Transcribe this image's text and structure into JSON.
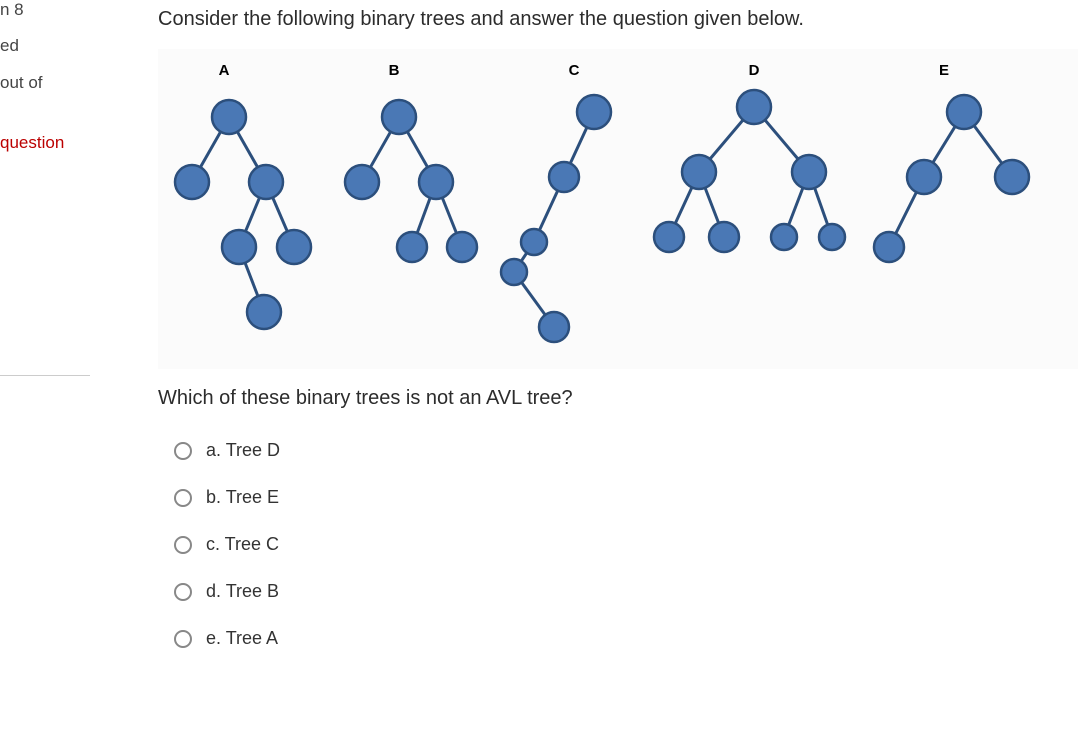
{
  "side": {
    "qnum": "n 8",
    "line2": "ed",
    "line3": "out of",
    "line4": "question"
  },
  "prompt": "Consider the following binary trees and answer the question given below.",
  "question": "Which of these binary trees is not an AVL tree?",
  "labels": {
    "a": "A",
    "b": "B",
    "c": "C",
    "d": "D",
    "e": "E"
  },
  "choices": {
    "a": "a. Tree D",
    "b": "b. Tree E",
    "c": "c. Tree C",
    "d": "d. Tree B",
    "e": "e. Tree A"
  },
  "chart_data": {
    "type": "diagram",
    "description": "Five binary trees labeled A through E drawn with blue nodes and edges.",
    "trees": {
      "A": {
        "root": 1,
        "edges": [
          [
            1,
            2,
            "left"
          ],
          [
            1,
            3,
            "right"
          ],
          [
            3,
            4,
            "left"
          ],
          [
            3,
            5,
            "right"
          ],
          [
            4,
            6,
            "right"
          ]
        ]
      },
      "B": {
        "root": 1,
        "edges": [
          [
            1,
            2,
            "left"
          ],
          [
            1,
            3,
            "right"
          ],
          [
            3,
            4,
            "left"
          ],
          [
            3,
            5,
            "right"
          ]
        ]
      },
      "C": {
        "root": 1,
        "edges": [
          [
            1,
            2,
            "left"
          ],
          [
            2,
            3,
            "left"
          ],
          [
            3,
            4,
            "left"
          ],
          [
            4,
            5,
            "right"
          ]
        ]
      },
      "D": {
        "root": 1,
        "edges": [
          [
            1,
            2,
            "left"
          ],
          [
            1,
            3,
            "right"
          ],
          [
            2,
            4,
            "left"
          ],
          [
            2,
            5,
            "right"
          ],
          [
            3,
            6,
            "left"
          ],
          [
            3,
            7,
            "right"
          ]
        ]
      },
      "E": {
        "root": 1,
        "edges": [
          [
            1,
            2,
            "left"
          ],
          [
            1,
            3,
            "right"
          ],
          [
            2,
            4,
            "left"
          ]
        ]
      }
    }
  }
}
